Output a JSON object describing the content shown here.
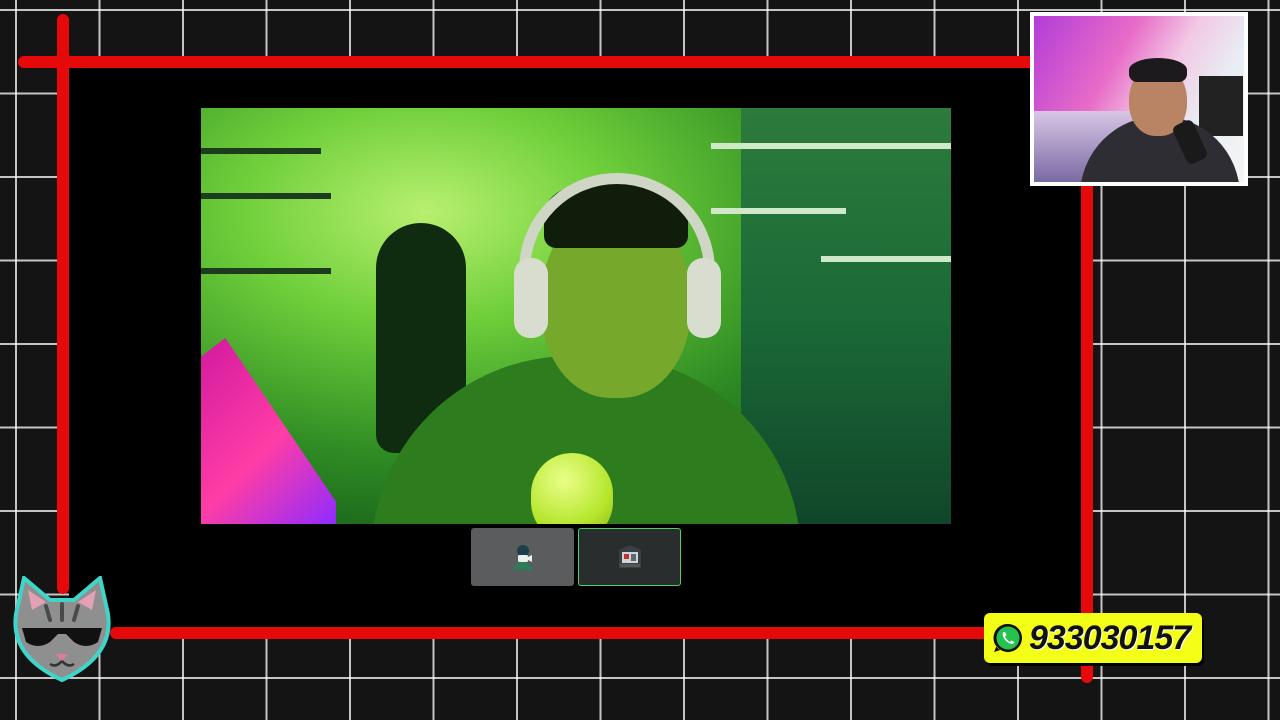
{
  "contact": {
    "whatsapp_number": "933030157",
    "icon": "whatsapp-icon"
  },
  "controls": {
    "camera_buttons": [
      {
        "icon": "camera-person-icon",
        "selected": false
      },
      {
        "icon": "desk-scene-icon",
        "selected": true
      }
    ]
  },
  "overlay": {
    "logo_icon": "cat-sunglasses-logo",
    "frame_color": "#e50909",
    "badge_color": "#f4ff18",
    "grid_background": "#141414"
  },
  "video": {
    "main_feed": "webcam-main",
    "pip_feed": "webcam-pip"
  }
}
